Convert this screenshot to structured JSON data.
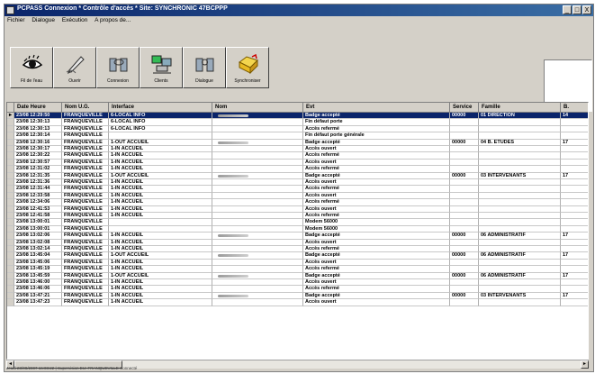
{
  "window": {
    "title": "PCPASS Connexion * Contrôle d'accès * Site: SYNCHRONIC 47BCPPP",
    "controls": [
      "_",
      "□",
      "X"
    ]
  },
  "menu": [
    "Fichier",
    "Dialogue",
    "Exécution",
    "A propos de..."
  ],
  "toolbar": [
    {
      "label": "Fil de l'eau",
      "icon": "eye-icon"
    },
    {
      "label": "Ouvrir",
      "icon": "pen-icon"
    },
    {
      "label": "Connexion",
      "icon": "connection-icon"
    },
    {
      "label": "Clients",
      "icon": "network-icon"
    },
    {
      "label": "Dialogue",
      "icon": "dialogue-icon"
    },
    {
      "label": "Synchroniser",
      "icon": "folder-sync-icon"
    }
  ],
  "table": {
    "columns": [
      "Date Heure",
      "Nom U.G.",
      "Interface",
      "Nom",
      "Evt",
      "Service",
      "Famille",
      "B."
    ],
    "rows": [
      {
        "date": "23/08 12:29:50",
        "ug": "FRANQUEVILLE",
        "iface": "6-LOCAL INFO",
        "nom": true,
        "evt": "Badge accepté",
        "service": "00000",
        "famille": "01 DIRECTION",
        "b": "14",
        "selected": true
      },
      {
        "date": "23/08 12:30:13",
        "ug": "FRANQUEVILLE",
        "iface": "6-LOCAL INFO",
        "nom": false,
        "evt": "Fin défaut porte",
        "service": "",
        "famille": "",
        "b": ""
      },
      {
        "date": "23/08 12:30:13",
        "ug": "FRANQUEVILLE",
        "iface": "6-LOCAL INFO",
        "nom": false,
        "evt": "Accès refermé",
        "service": "",
        "famille": "",
        "b": ""
      },
      {
        "date": "23/08 12:30:14",
        "ug": "FRANQUEVILLE",
        "iface": "",
        "nom": false,
        "evt": "Fin défaut porte générale",
        "service": "",
        "famille": "",
        "b": ""
      },
      {
        "date": "23/08 12:30:16",
        "ug": "FRANQUEVILLE",
        "iface": "1-OUT ACCUEIL",
        "nom": true,
        "evt": "Badge accepté",
        "service": "00000",
        "famille": "04 B. ETUDES",
        "b": "17"
      },
      {
        "date": "23/08 12:30:17",
        "ug": "FRANQUEVILLE",
        "iface": "1-IN ACCUEIL",
        "nom": false,
        "evt": "Accès ouvert",
        "service": "",
        "famille": "",
        "b": ""
      },
      {
        "date": "23/08 12:30:22",
        "ug": "FRANQUEVILLE",
        "iface": "1-IN ACCUEIL",
        "nom": false,
        "evt": "Accès refermé",
        "service": "",
        "famille": "",
        "b": ""
      },
      {
        "date": "23/08 12:30:57",
        "ug": "FRANQUEVILLE",
        "iface": "1-IN ACCUEIL",
        "nom": false,
        "evt": "Accès ouvert",
        "service": "",
        "famille": "",
        "b": ""
      },
      {
        "date": "23/08 12:31:02",
        "ug": "FRANQUEVILLE",
        "iface": "1-IN ACCUEIL",
        "nom": false,
        "evt": "Accès refermé",
        "service": "",
        "famille": "",
        "b": ""
      },
      {
        "date": "23/08 12:31:35",
        "ug": "FRANQUEVILLE",
        "iface": "1-OUT ACCUEIL",
        "nom": true,
        "evt": "Badge accepté",
        "service": "00000",
        "famille": "03 INTERVENANTS",
        "b": "17"
      },
      {
        "date": "23/08 12:31:36",
        "ug": "FRANQUEVILLE",
        "iface": "1-IN ACCUEIL",
        "nom": false,
        "evt": "Accès ouvert",
        "service": "",
        "famille": "",
        "b": ""
      },
      {
        "date": "23/08 12:31:44",
        "ug": "FRANQUEVILLE",
        "iface": "1-IN ACCUEIL",
        "nom": false,
        "evt": "Accès refermé",
        "service": "",
        "famille": "",
        "b": ""
      },
      {
        "date": "23/08 12:33:58",
        "ug": "FRANQUEVILLE",
        "iface": "1-IN ACCUEIL",
        "nom": false,
        "evt": "Accès ouvert",
        "service": "",
        "famille": "",
        "b": ""
      },
      {
        "date": "23/08 12:34:06",
        "ug": "FRANQUEVILLE",
        "iface": "1-IN ACCUEIL",
        "nom": false,
        "evt": "Accès refermé",
        "service": "",
        "famille": "",
        "b": ""
      },
      {
        "date": "23/08 12:41:53",
        "ug": "FRANQUEVILLE",
        "iface": "1-IN ACCUEIL",
        "nom": false,
        "evt": "Accès ouvert",
        "service": "",
        "famille": "",
        "b": ""
      },
      {
        "date": "23/08 12:41:58",
        "ug": "FRANQUEVILLE",
        "iface": "1-IN ACCUEIL",
        "nom": false,
        "evt": "Accès refermé",
        "service": "",
        "famille": "",
        "b": ""
      },
      {
        "date": "23/08 13:00:01",
        "ug": "FRANQUEVILLE",
        "iface": "",
        "nom": false,
        "evt": "Modem  56000",
        "service": "",
        "famille": "",
        "b": ""
      },
      {
        "date": "23/08 13:00:01",
        "ug": "FRANQUEVILLE",
        "iface": "",
        "nom": false,
        "evt": "Modem  56000",
        "service": "",
        "famille": "",
        "b": ""
      },
      {
        "date": "23/08 13:02:06",
        "ug": "FRANQUEVILLE",
        "iface": "1-IN ACCUEIL",
        "nom": true,
        "evt": "Badge accepté",
        "service": "00000",
        "famille": "06 ADMINISTRATIF",
        "b": "17"
      },
      {
        "date": "23/08 13:02:08",
        "ug": "FRANQUEVILLE",
        "iface": "1-IN ACCUEIL",
        "nom": false,
        "evt": "Accès ouvert",
        "service": "",
        "famille": "",
        "b": ""
      },
      {
        "date": "23/08 13:02:14",
        "ug": "FRANQUEVILLE",
        "iface": "1-IN ACCUEIL",
        "nom": false,
        "evt": "Accès refermé",
        "service": "",
        "famille": "",
        "b": ""
      },
      {
        "date": "23/08 13:45:04",
        "ug": "FRANQUEVILLE",
        "iface": "1-OUT ACCUEIL",
        "nom": true,
        "evt": "Badge accepté",
        "service": "00000",
        "famille": "06 ADMINISTRATIF",
        "b": "17"
      },
      {
        "date": "23/08 13:45:06",
        "ug": "FRANQUEVILLE",
        "iface": "1-IN ACCUEIL",
        "nom": false,
        "evt": "Accès ouvert",
        "service": "",
        "famille": "",
        "b": ""
      },
      {
        "date": "23/08 13:45:19",
        "ug": "FRANQUEVILLE",
        "iface": "1-IN ACCUEIL",
        "nom": false,
        "evt": "Accès refermé",
        "service": "",
        "famille": "",
        "b": ""
      },
      {
        "date": "23/08 13:45:59",
        "ug": "FRANQUEVILLE",
        "iface": "1-OUT ACCUEIL",
        "nom": true,
        "evt": "Badge accepté",
        "service": "00000",
        "famille": "06 ADMINISTRATIF",
        "b": "17"
      },
      {
        "date": "23/08 13:46:00",
        "ug": "FRANQUEVILLE",
        "iface": "1-IN ACCUEIL",
        "nom": false,
        "evt": "Accès ouvert",
        "service": "",
        "famille": "",
        "b": ""
      },
      {
        "date": "23/08 13:46:06",
        "ug": "FRANQUEVILLE",
        "iface": "1-IN ACCUEIL",
        "nom": false,
        "evt": "Accès refermé",
        "service": "",
        "famille": "",
        "b": ""
      },
      {
        "date": "23/08 13:47:21",
        "ug": "FRANQUEVILLE",
        "iface": "1-IN ACCUEIL",
        "nom": true,
        "evt": "Badge accepté",
        "service": "00000",
        "famille": "03 INTERVENANTS",
        "b": "17"
      },
      {
        "date": "23/08 13:47:23",
        "ug": "FRANQUEVILLE",
        "iface": "1-IN ACCUEIL",
        "nom": false,
        "evt": "Accès ouvert",
        "service": "",
        "famille": "",
        "b": ""
      }
    ]
  },
  "status": "Jeudi 23/08/2007  16:08:22 | Supervision EU: FRANQUEVILLE Connecté",
  "colors": {
    "selection": "#0a246a",
    "face": "#d4d0c8",
    "title_start": "#0a246a",
    "title_end": "#3a6ea5"
  }
}
